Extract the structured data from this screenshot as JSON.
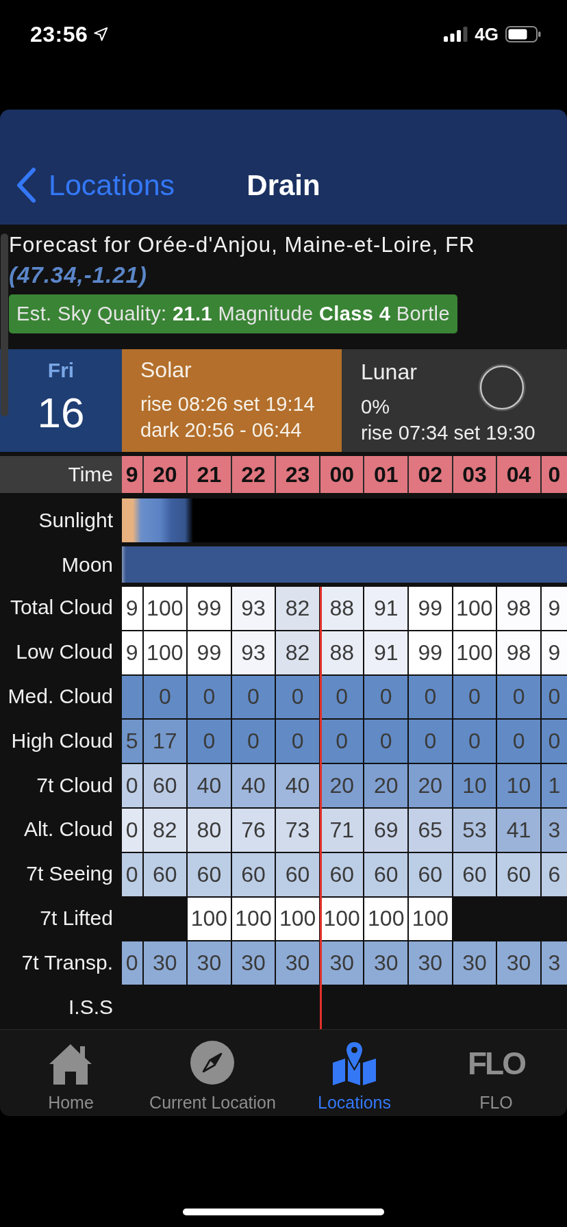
{
  "status_bar": {
    "time": "23:56",
    "network": "4G"
  },
  "nav": {
    "back": "Locations",
    "title": "Drain"
  },
  "forecast": {
    "location": "Forecast for Orée-d'Anjou, Maine-et-Loire, FR",
    "coordinates": "(47.34,-1.21)",
    "sky_quality": "Est. Sky Quality: **21.1** Magnitude **Class 4** Bortle"
  },
  "day": {
    "weekday": "Fri",
    "date": "16"
  },
  "solar": {
    "title": "Solar",
    "lines": [
      "rise 08:26 set 19:14",
      "dark 20:56 - 06:44"
    ]
  },
  "lunar": {
    "title": "Lunar",
    "illumination": "0%",
    "times": "rise 07:34 set 19:30"
  },
  "grid": {
    "time_label": "Time",
    "hours": [
      {
        "label": "9",
        "now": false
      },
      {
        "label": "20",
        "now": false
      },
      {
        "label": "21",
        "now": false
      },
      {
        "label": "22",
        "now": false
      },
      {
        "label": "23",
        "now": false
      },
      {
        "label": "00",
        "now": true
      },
      {
        "label": "01",
        "now": false
      },
      {
        "label": "02",
        "now": false
      },
      {
        "label": "03",
        "now": false
      },
      {
        "label": "04",
        "now": false
      },
      {
        "label": "0",
        "now": false
      }
    ],
    "rows": [
      {
        "label": "Sunlight",
        "kind": "sunlight"
      },
      {
        "label": "Moon",
        "kind": "moon"
      },
      {
        "label": "Total Cloud",
        "kind": "cells",
        "cells": [
          {
            "value": "9",
            "color": "#ffffff"
          },
          {
            "value": "100",
            "color": "#ffffff"
          },
          {
            "value": "99",
            "color": "#ffffff"
          },
          {
            "value": "93",
            "color": "#f3f5fa"
          },
          {
            "value": "82",
            "color": "#dce3ef"
          },
          {
            "value": "88",
            "color": "#e9edf6"
          },
          {
            "value": "91",
            "color": "#edf0f8"
          },
          {
            "value": "99",
            "color": "#ffffff"
          },
          {
            "value": "100",
            "color": "#ffffff"
          },
          {
            "value": "98",
            "color": "#fcfcfe"
          },
          {
            "value": "9",
            "color": "#fcfcfe"
          }
        ]
      },
      {
        "label": "Low Cloud",
        "kind": "cells",
        "cells": [
          {
            "value": "9",
            "color": "#ffffff"
          },
          {
            "value": "100",
            "color": "#ffffff"
          },
          {
            "value": "99",
            "color": "#ffffff"
          },
          {
            "value": "93",
            "color": "#f3f5fa"
          },
          {
            "value": "82",
            "color": "#dce3ef"
          },
          {
            "value": "88",
            "color": "#e9edf6"
          },
          {
            "value": "91",
            "color": "#edf0f8"
          },
          {
            "value": "99",
            "color": "#ffffff"
          },
          {
            "value": "100",
            "color": "#ffffff"
          },
          {
            "value": "98",
            "color": "#fcfcfe"
          },
          {
            "value": "9",
            "color": "#fcfcfe"
          }
        ]
      },
      {
        "label": "Med. Cloud",
        "kind": "cells",
        "cells": [
          {
            "color": "#628bc6"
          },
          {
            "value": "0",
            "color": "#628bc6"
          },
          {
            "value": "0",
            "color": "#628bc6"
          },
          {
            "value": "0",
            "color": "#628bc6"
          },
          {
            "value": "0",
            "color": "#628bc6"
          },
          {
            "value": "0",
            "color": "#628bc6"
          },
          {
            "value": "0",
            "color": "#628bc6"
          },
          {
            "value": "0",
            "color": "#628bc6"
          },
          {
            "value": "0",
            "color": "#628bc6"
          },
          {
            "value": "0",
            "color": "#628bc6"
          },
          {
            "value": "0",
            "color": "#628bc6"
          }
        ]
      },
      {
        "label": "High Cloud",
        "kind": "cells",
        "cells": [
          {
            "value": "5",
            "color": "#6f95ca"
          },
          {
            "value": "17",
            "color": "#7599cd"
          },
          {
            "value": "0",
            "color": "#628bc6"
          },
          {
            "value": "0",
            "color": "#628bc6"
          },
          {
            "value": "0",
            "color": "#628bc6"
          },
          {
            "value": "0",
            "color": "#628bc6"
          },
          {
            "value": "0",
            "color": "#628bc6"
          },
          {
            "value": "0",
            "color": "#628bc6"
          },
          {
            "value": "0",
            "color": "#628bc6"
          },
          {
            "value": "0",
            "color": "#628bc6"
          },
          {
            "value": "0",
            "color": "#628bc6"
          }
        ]
      },
      {
        "label": "7t Cloud",
        "kind": "cells",
        "cells": [
          {
            "value": "0",
            "color": "#bfcfe7"
          },
          {
            "value": "60",
            "color": "#bccbe5"
          },
          {
            "value": "40",
            "color": "#9fb7dc"
          },
          {
            "value": "40",
            "color": "#9fb7dc"
          },
          {
            "value": "40",
            "color": "#9fb7dc"
          },
          {
            "value": "20",
            "color": "#7f9fd1"
          },
          {
            "value": "20",
            "color": "#7f9fd1"
          },
          {
            "value": "20",
            "color": "#7f9fd1"
          },
          {
            "value": "10",
            "color": "#6f94cb"
          },
          {
            "value": "10",
            "color": "#6f94cb"
          },
          {
            "value": "1",
            "color": "#6f94cb"
          }
        ]
      },
      {
        "label": "Alt. Cloud",
        "kind": "cells",
        "cells": [
          {
            "value": "0",
            "color": "#e2e8f3"
          },
          {
            "value": "82",
            "color": "#dce3f0"
          },
          {
            "value": "80",
            "color": "#dae2f0"
          },
          {
            "value": "76",
            "color": "#d5deee"
          },
          {
            "value": "73",
            "color": "#d1dbec"
          },
          {
            "value": "71",
            "color": "#cdd8eb"
          },
          {
            "value": "69",
            "color": "#cad5ea"
          },
          {
            "value": "65",
            "color": "#c3d0e7"
          },
          {
            "value": "53",
            "color": "#afc2e0"
          },
          {
            "value": "41",
            "color": "#9bb3d8"
          },
          {
            "value": "3",
            "color": "#97b0d7"
          }
        ]
      },
      {
        "label": "7t Seeing",
        "kind": "cells",
        "cells": [
          {
            "value": "0",
            "color": "#bccde6"
          },
          {
            "value": "60",
            "color": "#bccde6"
          },
          {
            "value": "60",
            "color": "#bccde6"
          },
          {
            "value": "60",
            "color": "#bccde6"
          },
          {
            "value": "60",
            "color": "#bccde6"
          },
          {
            "value": "60",
            "color": "#bccde6"
          },
          {
            "value": "60",
            "color": "#bccde6"
          },
          {
            "value": "60",
            "color": "#bccde6"
          },
          {
            "value": "60",
            "color": "#bccde6"
          },
          {
            "value": "60",
            "color": "#bccde6"
          },
          {
            "value": "6",
            "color": "#bccde6"
          }
        ]
      },
      {
        "label": "7t Lifted",
        "kind": "cells",
        "cells": [
          null,
          null,
          {
            "value": "100",
            "color": "#ffffff"
          },
          {
            "value": "100",
            "color": "#ffffff"
          },
          {
            "value": "100",
            "color": "#ffffff"
          },
          {
            "value": "100",
            "color": "#ffffff"
          },
          {
            "value": "100",
            "color": "#ffffff"
          },
          {
            "value": "100",
            "color": "#ffffff"
          },
          null,
          null,
          null
        ]
      },
      {
        "label": "7t Transp.",
        "kind": "cells",
        "cells": [
          {
            "value": "0",
            "color": "#8eabd6"
          },
          {
            "value": "30",
            "color": "#8eabd6"
          },
          {
            "value": "30",
            "color": "#8eabd6"
          },
          {
            "value": "30",
            "color": "#8eabd6"
          },
          {
            "value": "30",
            "color": "#8eabd6"
          },
          {
            "value": "30",
            "color": "#8eabd6"
          },
          {
            "value": "30",
            "color": "#8eabd6"
          },
          {
            "value": "30",
            "color": "#8eabd6"
          },
          {
            "value": "30",
            "color": "#8eabd6"
          },
          {
            "value": "30",
            "color": "#8eabd6"
          },
          {
            "value": "3",
            "color": "#8eabd6"
          }
        ]
      },
      {
        "label": "I.S.S",
        "kind": "cells"
      }
    ]
  },
  "tabs": [
    {
      "label": "Home",
      "selected": false
    },
    {
      "label": "Current Location",
      "selected": false
    },
    {
      "label": "Locations",
      "selected": true
    },
    {
      "label": "FLO",
      "selected": false,
      "logo": "FLO"
    }
  ]
}
